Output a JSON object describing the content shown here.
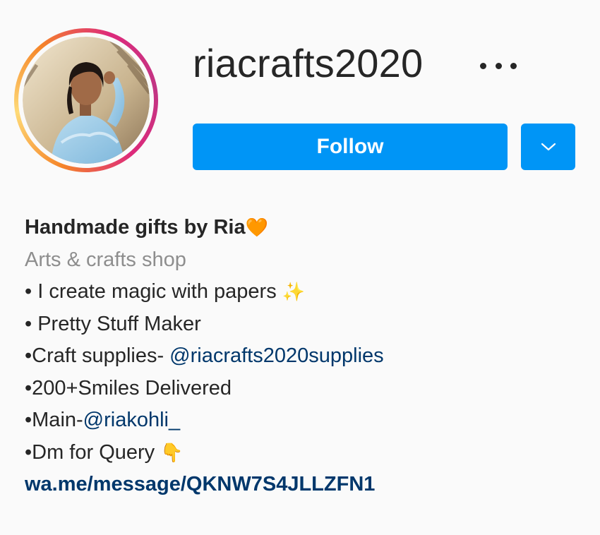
{
  "profile": {
    "username": "riacrafts2020",
    "follow_label": "Follow",
    "more_icon": "ellipsis-icon",
    "dropdown_icon": "chevron-down-icon"
  },
  "bio": {
    "name": "Handmade gifts by Ria",
    "name_emoji": "🧡",
    "category": "Arts & crafts shop",
    "line1_text": "• I create magic with papers ",
    "line1_emoji": "✨",
    "line2_text": "• Pretty Stuff Maker",
    "line3_prefix": "•Craft supplies- ",
    "line3_mention": "@riacrafts2020supplies",
    "line4_text": "•200+Smiles Delivered",
    "line5_prefix": "•Main-",
    "line5_mention": "@riakohli_",
    "line6_text": "•Dm for Query ",
    "line6_emoji": "👇",
    "website": "wa.me/message/QKNW7S4JLLZFN1"
  },
  "colors": {
    "follow_blue": "#0095f6",
    "link_blue": "#00376b",
    "category_gray": "#8e8e8e",
    "background": "#fafafa"
  }
}
